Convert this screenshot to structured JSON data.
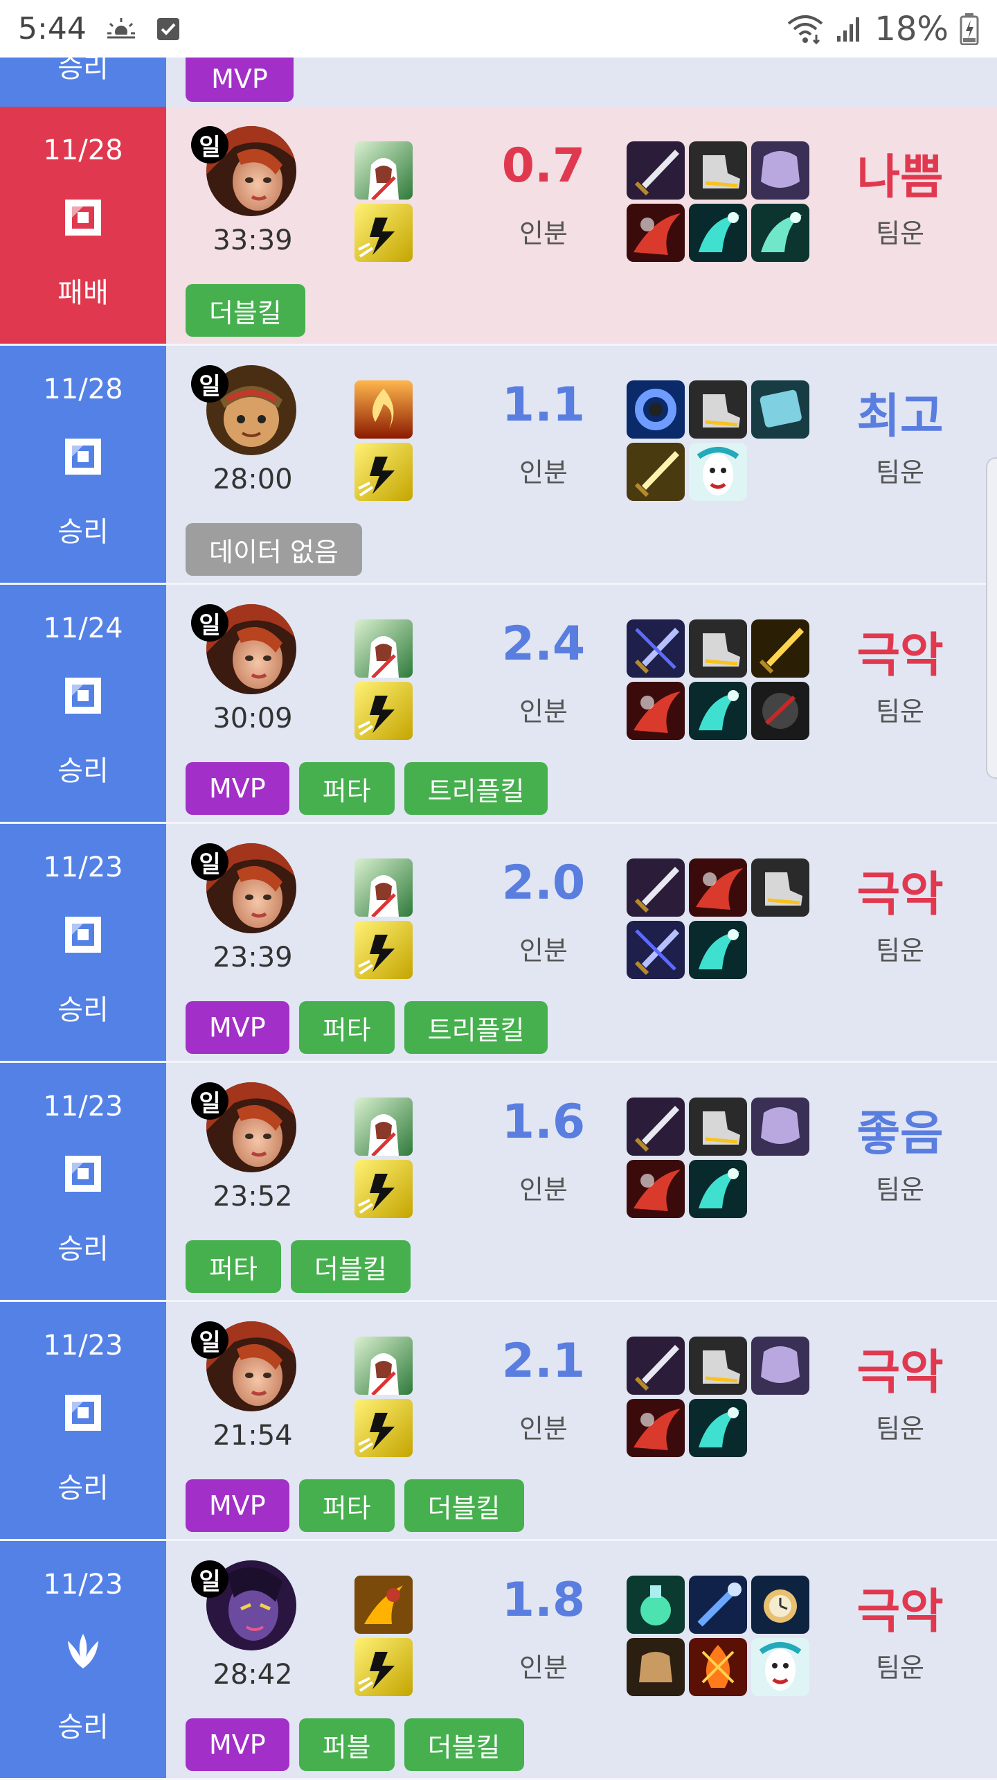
{
  "status": {
    "time": "5:44",
    "battery": "18%"
  },
  "top_partial": {
    "result": "승리",
    "tag": "MVP"
  },
  "score_label": "인분",
  "luck_label": "팀운",
  "matches": [
    {
      "date": "11/28",
      "result": "패배",
      "loss": true,
      "mode": "swift",
      "duration": "33:39",
      "badge": "일",
      "champion": "Miss Fortune",
      "score": "0.7",
      "score_bad": true,
      "luck": "나쁨",
      "luck_color": "red",
      "spells": [
        "ghost",
        "flash"
      ],
      "items": [
        "sword",
        "boots",
        "armor",
        "claw",
        "teal",
        "pick"
      ],
      "tags": [
        {
          "label": "더블킬",
          "kind": "green"
        }
      ]
    },
    {
      "date": "11/28",
      "result": "승리",
      "loss": false,
      "mode": "swift",
      "duration": "28:00",
      "badge": "일",
      "champion": "Teemo",
      "score": "1.1",
      "score_bad": false,
      "luck": "최고",
      "luck_color": "blue",
      "spells": [
        "ignite",
        "flash"
      ],
      "items": [
        "ring",
        "boots",
        "book",
        "blade",
        "mask"
      ],
      "tags": [
        {
          "label": "데이터 없음",
          "kind": "gray"
        }
      ]
    },
    {
      "date": "11/24",
      "result": "승리",
      "loss": false,
      "mode": "swift",
      "duration": "30:09",
      "badge": "일",
      "champion": "Miss Fortune",
      "score": "2.4",
      "score_bad": false,
      "luck": "극악",
      "luck_color": "red",
      "spells": [
        "ghost",
        "flash"
      ],
      "items": [
        "xsword",
        "boots",
        "dagger",
        "claw",
        "teal",
        "dark"
      ],
      "tags": [
        {
          "label": "MVP",
          "kind": "mvp"
        },
        {
          "label": "퍼타",
          "kind": "green"
        },
        {
          "label": "트리플킬",
          "kind": "green"
        }
      ]
    },
    {
      "date": "11/23",
      "result": "승리",
      "loss": false,
      "mode": "swift",
      "duration": "23:39",
      "badge": "일",
      "champion": "Miss Fortune",
      "score": "2.0",
      "score_bad": false,
      "luck": "극악",
      "luck_color": "red",
      "spells": [
        "ghost",
        "flash"
      ],
      "items": [
        "sword",
        "claw",
        "boots",
        "xsword",
        "teal"
      ],
      "tags": [
        {
          "label": "MVP",
          "kind": "mvp"
        },
        {
          "label": "퍼타",
          "kind": "green"
        },
        {
          "label": "트리플킬",
          "kind": "green"
        }
      ]
    },
    {
      "date": "11/23",
      "result": "승리",
      "loss": false,
      "mode": "swift",
      "duration": "23:52",
      "badge": "일",
      "champion": "Miss Fortune",
      "score": "1.6",
      "score_bad": false,
      "luck": "좋음",
      "luck_color": "blue",
      "spells": [
        "ghost",
        "flash"
      ],
      "items": [
        "sword",
        "boots",
        "armor",
        "claw",
        "teal"
      ],
      "tags": [
        {
          "label": "퍼타",
          "kind": "green"
        },
        {
          "label": "더블킬",
          "kind": "green"
        }
      ]
    },
    {
      "date": "11/23",
      "result": "승리",
      "loss": false,
      "mode": "swift",
      "duration": "21:54",
      "badge": "일",
      "champion": "Miss Fortune",
      "score": "2.1",
      "score_bad": false,
      "luck": "극악",
      "luck_color": "red",
      "spells": [
        "ghost",
        "flash"
      ],
      "items": [
        "sword",
        "boots",
        "armor",
        "claw",
        "teal"
      ],
      "tags": [
        {
          "label": "MVP",
          "kind": "mvp"
        },
        {
          "label": "퍼타",
          "kind": "green"
        },
        {
          "label": "더블킬",
          "kind": "green"
        }
      ]
    },
    {
      "date": "11/23",
      "result": "승리",
      "loss": false,
      "mode": "aram",
      "duration": "28:42",
      "badge": "일",
      "champion": "Evelynn",
      "score": "1.8",
      "score_bad": false,
      "luck": "극악",
      "luck_color": "red",
      "spells": [
        "strike",
        "flash"
      ],
      "items": [
        "potion",
        "wand",
        "watch",
        "gauntlet",
        "fire",
        "mask"
      ],
      "tags": [
        {
          "label": "MVP",
          "kind": "mvp"
        },
        {
          "label": "퍼블",
          "kind": "green"
        },
        {
          "label": "더블킬",
          "kind": "green"
        }
      ]
    }
  ]
}
